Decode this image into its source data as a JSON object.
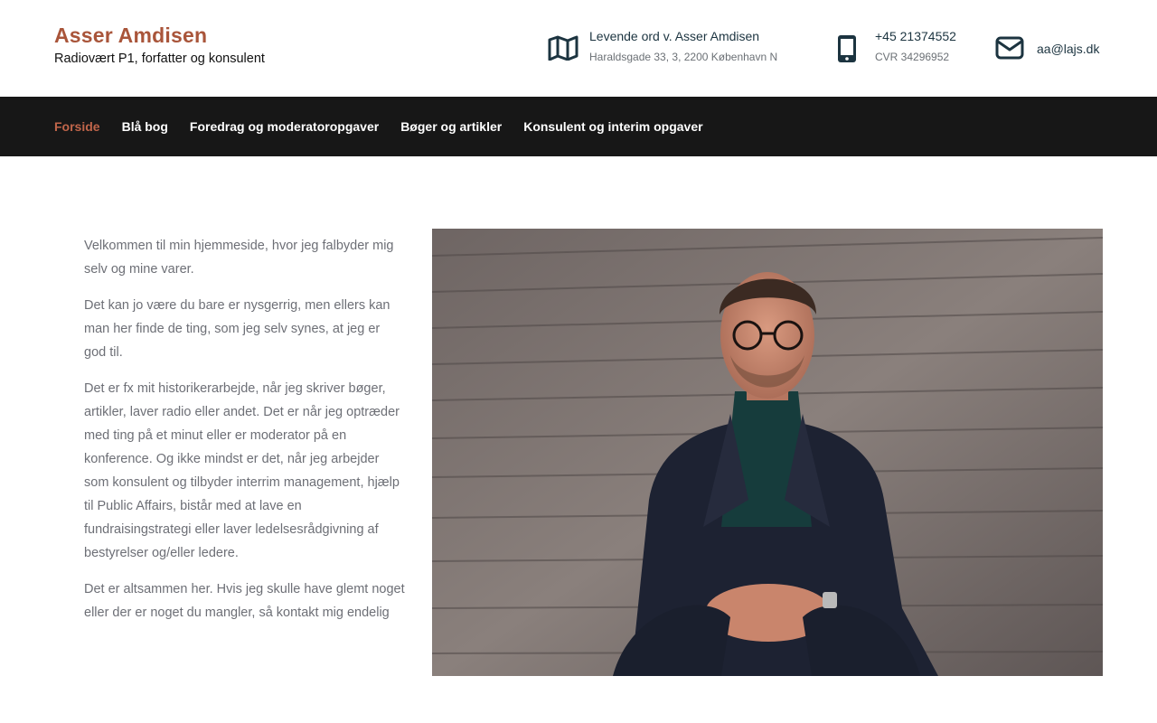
{
  "brand": {
    "name": "Asser Amdisen",
    "tagline": "Radiovært P1, forfatter og konsulent"
  },
  "contact": {
    "address": {
      "icon": "map-icon",
      "title": "Levende ord v. Asser Amdisen",
      "detail": "Haraldsgade 33, 3, 2200 København N"
    },
    "phone": {
      "icon": "mobile-phone-icon",
      "title": "+45 21374552",
      "detail": "CVR 34296952"
    },
    "email": {
      "icon": "envelope-icon",
      "title": "aa@lajs.dk"
    }
  },
  "nav": {
    "items": [
      {
        "label": "Forside",
        "active": true
      },
      {
        "label": "Blå bog",
        "active": false
      },
      {
        "label": "Foredrag og moderatoropgaver",
        "active": false
      },
      {
        "label": "Bøger og artikler",
        "active": false
      },
      {
        "label": "Konsulent og interim opgaver",
        "active": false
      }
    ]
  },
  "main": {
    "paragraphs": [
      "Velkommen til min hjemmeside, hvor jeg falbyder mig selv og mine varer.",
      "Det kan jo være du bare er nysgerrig, men ellers kan man her finde de ting, som jeg selv synes, at jeg er god til.",
      "Det er fx mit historikerarbejde, når jeg skriver bøger, artikler, laver radio eller andet. Det er når jeg optræder med ting på et minut eller er moderator på en konference. Og ikke mindst er det, når jeg arbejder som konsulent og tilbyder interrim management, hjælp til Public Affairs, bistår med at lave en fundraisingstrategi eller laver ledelsesrådgivning af bestyrelser og/eller ledere.",
      "Det er altsammen her. Hvis jeg skulle have glemt noget eller der er noget du mangler, så kontakt mig endelig"
    ]
  },
  "colors": {
    "brand": "#a9553a",
    "nav_bg": "#171717",
    "nav_active": "#c0654a",
    "icon": "#1c3440",
    "body_text": "#6d6f76"
  }
}
